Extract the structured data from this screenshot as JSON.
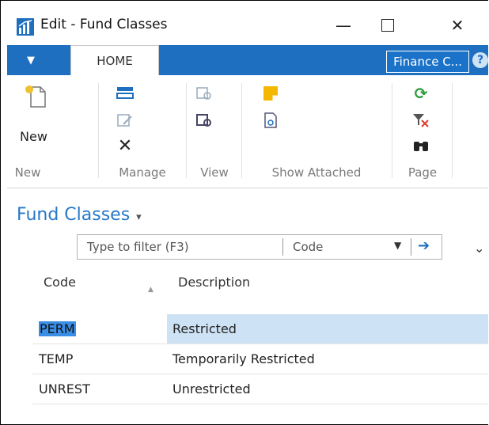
{
  "window": {
    "title": "Edit - Fund Classes"
  },
  "ribbon": {
    "tab_home": "HOME",
    "company": "Finance C...",
    "help": "?",
    "groups": {
      "new": {
        "label": "New",
        "button": "New"
      },
      "manage": {
        "label": "Manage"
      },
      "view": {
        "label": "View"
      },
      "attached": {
        "label": "Show Attached"
      },
      "page": {
        "label": "Page"
      }
    }
  },
  "page": {
    "title": "Fund Classes"
  },
  "filter": {
    "placeholder": "Type to filter (F3)",
    "field": "Code"
  },
  "table": {
    "columns": [
      "Code",
      "Description"
    ],
    "rows": [
      {
        "code": "PERM",
        "description": "Restricted",
        "selected": true
      },
      {
        "code": "TEMP",
        "description": "Temporarily Restricted",
        "selected": false
      },
      {
        "code": "UNREST",
        "description": "Unrestricted",
        "selected": false
      }
    ]
  },
  "colors": {
    "accent": "#1e6fbf",
    "selection": "#cde3f5",
    "title": "#2878c8"
  }
}
